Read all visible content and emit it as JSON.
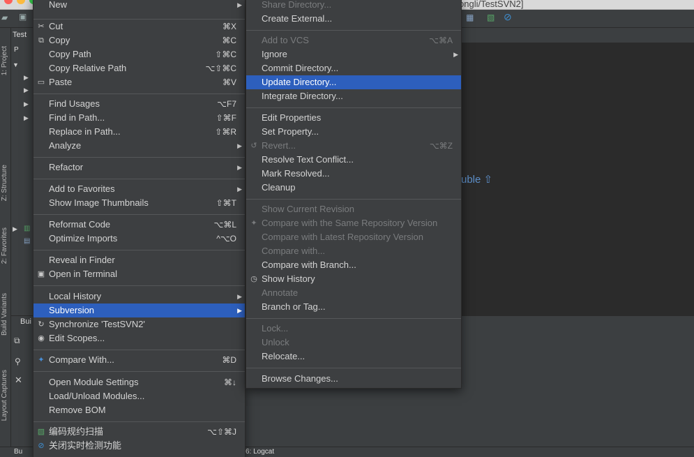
{
  "window": {
    "title": "ongli/TestSVN2]"
  },
  "side_tabs": [
    "1: Project",
    "Z: Structure",
    "2: Favorites",
    "Build Variants",
    "Layout Captures"
  ],
  "project": {
    "label": "Test",
    "row_label": "P"
  },
  "editor": {
    "hint": "uble ⇧"
  },
  "bottom": {
    "tab_label": "Bui"
  },
  "status": {
    "build_label": "Bu",
    "logcat_label": "6: Logcat"
  },
  "main_menu": {
    "items": [
      {
        "label": "New",
        "shortcut": "",
        "submenu": true
      },
      {
        "label": "Cut",
        "shortcut": "⌘X",
        "icon": "cut-icon"
      },
      {
        "label": "Copy",
        "shortcut": "⌘C",
        "icon": "copy-icon"
      },
      {
        "label": "Copy Path",
        "shortcut": "⇧⌘C"
      },
      {
        "label": "Copy Relative Path",
        "shortcut": "⌥⇧⌘C"
      },
      {
        "label": "Paste",
        "shortcut": "⌘V",
        "icon": "paste-icon"
      },
      {
        "label": "Find Usages",
        "shortcut": "⌥F7"
      },
      {
        "label": "Find in Path...",
        "shortcut": "⇧⌘F"
      },
      {
        "label": "Replace in Path...",
        "shortcut": "⇧⌘R"
      },
      {
        "label": "Analyze",
        "shortcut": "",
        "submenu": true
      },
      {
        "label": "Refactor",
        "shortcut": "",
        "submenu": true
      },
      {
        "label": "Add to Favorites",
        "shortcut": "",
        "submenu": true
      },
      {
        "label": "Show Image Thumbnails",
        "shortcut": "⇧⌘T"
      },
      {
        "label": "Reformat Code",
        "shortcut": "⌥⌘L"
      },
      {
        "label": "Optimize Imports",
        "shortcut": "^⌥O"
      },
      {
        "label": "Reveal in Finder",
        "shortcut": ""
      },
      {
        "label": "Open in Terminal",
        "shortcut": "",
        "icon": "terminal-icon"
      },
      {
        "label": "Local History",
        "shortcut": "",
        "submenu": true
      },
      {
        "label": "Subversion",
        "shortcut": "",
        "submenu": true,
        "selected": true
      },
      {
        "label": "Synchronize 'TestSVN2'",
        "shortcut": "",
        "icon": "sync-icon"
      },
      {
        "label": "Edit Scopes...",
        "shortcut": "",
        "icon": "scope-icon"
      },
      {
        "label": "Compare With...",
        "shortcut": "⌘D",
        "icon": "compare-icon"
      },
      {
        "label": "Open Module Settings",
        "shortcut": "⌘↓"
      },
      {
        "label": "Load/Unload Modules...",
        "shortcut": ""
      },
      {
        "label": "Remove BOM",
        "shortcut": ""
      },
      {
        "label": "编码规约扫描",
        "shortcut": "⌥⇧⌘J",
        "icon": "scan-icon"
      },
      {
        "label": "关闭实时检测功能",
        "shortcut": "",
        "icon": "disable-icon"
      }
    ]
  },
  "sub_menu": {
    "items": [
      {
        "label": "Share Directory...",
        "disabled": true
      },
      {
        "label": "Create External..."
      },
      {
        "label": "Add to VCS",
        "shortcut": "⌥⌘A",
        "disabled": true
      },
      {
        "label": "Ignore",
        "submenu": true
      },
      {
        "label": "Commit Directory..."
      },
      {
        "label": "Update Directory...",
        "selected": true
      },
      {
        "label": "Integrate Directory..."
      },
      {
        "label": "Edit Properties"
      },
      {
        "label": "Set Property..."
      },
      {
        "label": "Revert...",
        "shortcut": "⌥⌘Z",
        "disabled": true,
        "icon": "revert-icon"
      },
      {
        "label": "Resolve Text Conflict..."
      },
      {
        "label": "Mark Resolved..."
      },
      {
        "label": "Cleanup"
      },
      {
        "label": "Show Current Revision",
        "disabled": true
      },
      {
        "label": "Compare with the Same Repository Version",
        "disabled": true,
        "icon": "compare-icon"
      },
      {
        "label": "Compare with Latest Repository Version",
        "disabled": true
      },
      {
        "label": "Compare with...",
        "disabled": true
      },
      {
        "label": "Compare with Branch..."
      },
      {
        "label": "Show History",
        "icon": "history-icon"
      },
      {
        "label": "Annotate",
        "disabled": true
      },
      {
        "label": "Branch or Tag..."
      },
      {
        "label": "Lock...",
        "disabled": true
      },
      {
        "label": "Unlock",
        "disabled": true
      },
      {
        "label": "Relocate..."
      },
      {
        "label": "Browse Changes..."
      }
    ]
  },
  "colors": {
    "selection": "#2d5fbd",
    "menu_bg": "#3d3f41",
    "disabled_text": "#7a7c7e"
  }
}
